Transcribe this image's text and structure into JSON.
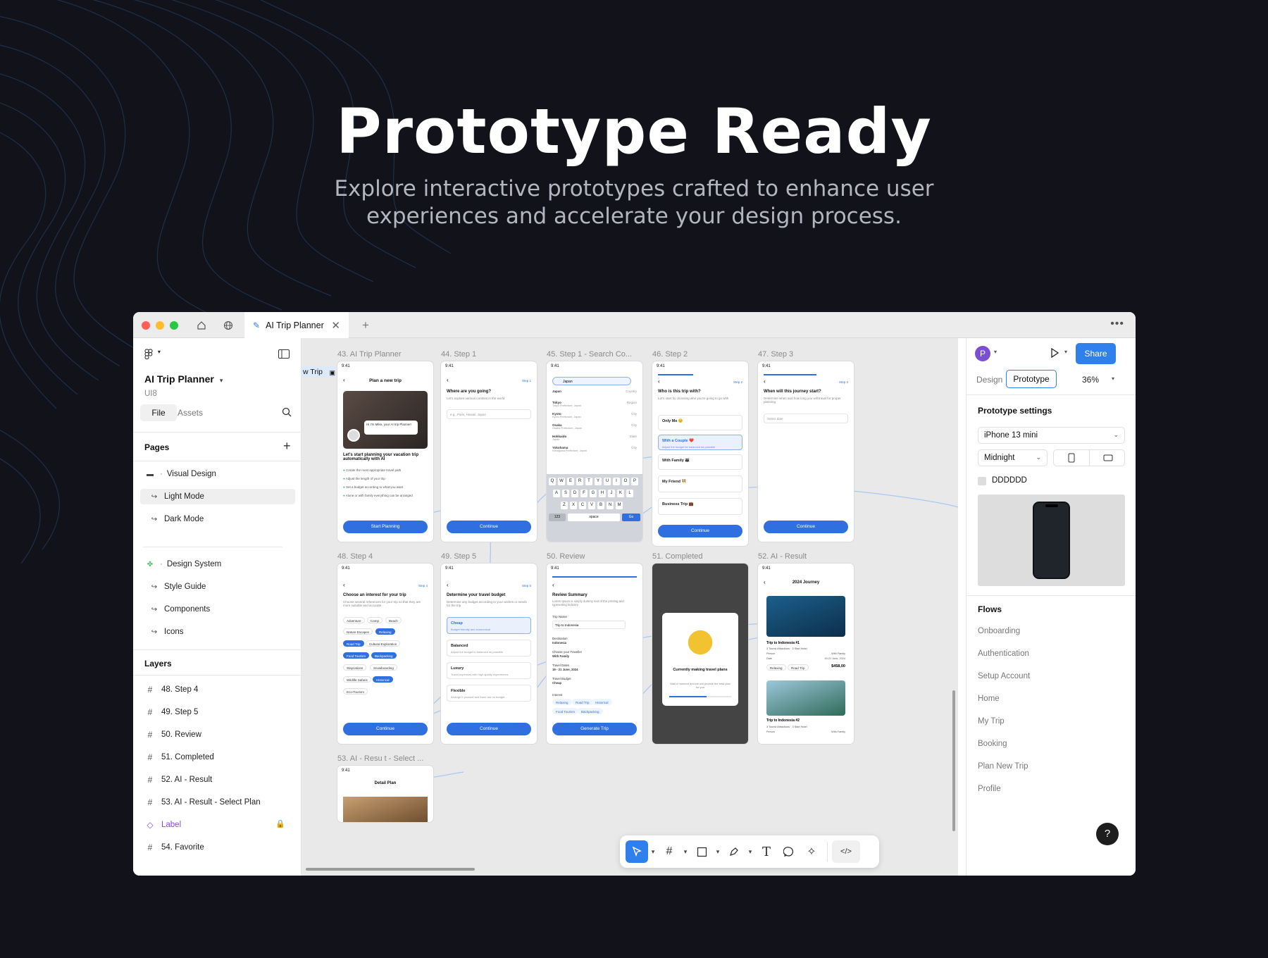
{
  "hero": {
    "title": "Prototype Ready",
    "subtitle_line1": "Explore interactive prototypes crafted to enhance user",
    "subtitle_line2": "experiences and accelerate your design process."
  },
  "tabbar": {
    "tab_label": "AI Trip Planner",
    "new_tab": "+",
    "more": "•••"
  },
  "left_panel": {
    "file_name": "AI Trip Planner",
    "team": "UI8",
    "tabs": [
      "File",
      "Assets"
    ],
    "pages_header": "Pages",
    "pages": [
      {
        "label": "Visual Design",
        "icon": "visual-design-icon"
      },
      {
        "label": "Light Mode",
        "icon": "return-arrow-icon",
        "selected": true
      },
      {
        "label": "Dark Mode",
        "icon": "return-arrow-icon"
      },
      {
        "label": "Design System",
        "icon": "design-system-icon"
      },
      {
        "label": "Style Guide",
        "icon": "return-arrow-icon"
      },
      {
        "label": "Components",
        "icon": "return-arrow-icon"
      },
      {
        "label": "Icons",
        "icon": "return-arrow-icon"
      }
    ],
    "layers_header": "Layers",
    "layers": [
      {
        "label": "48. Step 4",
        "icon": "frame-icon"
      },
      {
        "label": "49. Step 5",
        "icon": "frame-icon"
      },
      {
        "label": "50. Review",
        "icon": "frame-icon"
      },
      {
        "label": "51. Completed",
        "icon": "frame-icon"
      },
      {
        "label": "52. AI - Result",
        "icon": "frame-icon"
      },
      {
        "label": "53. AI - Result - Select Plan",
        "icon": "frame-icon"
      },
      {
        "label": "Label",
        "icon": "component-icon",
        "locked": true
      },
      {
        "label": "54. Favorite",
        "icon": "frame-icon"
      }
    ]
  },
  "canvas": {
    "edge_label": "w Trip",
    "frames": [
      "43. AI Trip Planner",
      "44. Step 1",
      "45. Step 1 - Search Co...",
      "46. Step 2",
      "47. Step 3",
      "48. Step 4",
      "49. Step 5",
      "50. Review",
      "51. Completed",
      "52. AI - Result",
      "53. AI - Resu t - Select ..."
    ],
    "screens": {
      "status_time": "9:41",
      "plan_title": "Plan a new trip",
      "plan_bubble": "Hi I'm Mike, your AI trip Planner!",
      "plan_heading": "Let's start planning your vacation trip automatically with AI",
      "plan_bullets": [
        "Create the most appropriate travel path",
        "Adjust the length of your trip",
        "Set a budget according to what you want",
        "Alone or with family everything can be arranged"
      ],
      "start_planning": "Start Planning",
      "continue": "Continue",
      "step1_q": "Where are you going?",
      "step1_hint": "Let's explore various contries in the world",
      "step1_placeholder": "e.g., Paris, Hawaii, Japan",
      "step_label": "Step 1",
      "search_value": "Japan",
      "search_results": [
        {
          "name": "Japan",
          "type": "Country",
          "sub": ""
        },
        {
          "name": "Tokyo",
          "type": "Region",
          "sub": "Tokyo Prefecture, Japan"
        },
        {
          "name": "Kyoto",
          "type": "City",
          "sub": "Kyoto Prefecture, Japan"
        },
        {
          "name": "Osaka",
          "type": "City",
          "sub": "Osaka Prefecture, Japan"
        },
        {
          "name": "Hokkaido",
          "type": "State",
          "sub": "Japan"
        },
        {
          "name": "Yokohama",
          "type": "City",
          "sub": "Kanagawa Prefecture, Japan"
        }
      ],
      "keyboard_rows": [
        [
          "Q",
          "W",
          "E",
          "R",
          "T",
          "Y",
          "U",
          "I",
          "O",
          "P"
        ],
        [
          "A",
          "S",
          "D",
          "F",
          "G",
          "H",
          "J",
          "K",
          "L"
        ],
        [
          "Z",
          "X",
          "C",
          "V",
          "B",
          "N",
          "M"
        ]
      ],
      "key_123": "123",
      "key_space": "space",
      "key_go": "Go",
      "step2_label": "Step 2",
      "step2_q": "Who is this trip with?",
      "step2_hint": "Let's start by choosing who you're going to go with",
      "step2_options": [
        "Only Me 😊",
        "With a Couple ❤️",
        "With Family 👨‍👩‍👧",
        "My Friend 👯",
        "Business Trip 💼"
      ],
      "step2_selected_hint": "Adjust the budget be balanced as possible",
      "step3_label": "Step 3",
      "step3_q": "When will this journey start?",
      "step3_hint": "Determine when and how long you will travel for proper planning",
      "step3_placeholder": "Select date",
      "step4_label": "Step 4",
      "step4_q": "Choose an interest for your trip",
      "step4_hint": "Choose several references for your trip so that they are more suitable and accurate",
      "interests": [
        {
          "label": "Adventure",
          "on": false
        },
        {
          "label": "Camp",
          "on": false
        },
        {
          "label": "Beach",
          "on": false
        },
        {
          "label": "Nature Escapes",
          "on": false
        },
        {
          "label": "Relaxing",
          "on": true
        },
        {
          "label": "Road Trip",
          "on": true
        },
        {
          "label": "Cultural Exploration",
          "on": false
        },
        {
          "label": "Food Tourism",
          "on": true
        },
        {
          "label": "Backpacking",
          "on": true
        },
        {
          "label": "Staycations",
          "on": false
        },
        {
          "label": "Snowboarding",
          "on": false
        },
        {
          "label": "Wildlife Safaris",
          "on": false
        },
        {
          "label": "Historical",
          "on": true
        },
        {
          "label": "Eco-Tourism",
          "on": false
        }
      ],
      "step5_label": "Step 5",
      "step5_q": "Determine your travel budget",
      "step5_hint": "Determine any budget according to your wishes or needs for the trip",
      "budgets": [
        {
          "t": "Cheap",
          "d": "Budget friendly and economical"
        },
        {
          "t": "Balanced",
          "d": "Adjust the budget to balanced as possible"
        },
        {
          "t": "Luxury",
          "d": "Travel expenses with high quality experiences"
        },
        {
          "t": "Flexible",
          "d": "Arrange it yourself and there are no budget..."
        }
      ],
      "review_title": "Review Summary",
      "review_hint": "Lorem Ipsum is simply dummy text of the printing and typesetting industry",
      "trip_name_label": "Trip Name",
      "trip_name": "Trip to Indonesia",
      "review_rows": [
        {
          "l": "Destination",
          "v": "Indonesia"
        },
        {
          "l": "Choose your Traveller",
          "v": "With Family"
        },
        {
          "l": "Travel Dates",
          "v": "19 - 21 June, 2024"
        },
        {
          "l": "Travel Budget",
          "v": "Cheap"
        }
      ],
      "interest_label": "Interest",
      "review_chips": [
        "Relaxing",
        "Road Trip",
        "Historical",
        "Food Tourism",
        "Backpacking"
      ],
      "generate_trip": "Generate Trip",
      "completed_title": "Currently making travel plans",
      "completed_hint": "Wait a moment and we will provide the best plan for you",
      "result_title": "2024 Journey",
      "result_trip1": "Trip to Indonesia #1",
      "result_trip2": "Trip to Indonesia #2",
      "result_meta1": "3 Tourist Attractions",
      "result_meta2": "3 Start Hotel",
      "result_person_l": "Person",
      "result_person_v": "With Family",
      "result_date_l": "Date",
      "result_date_v": "19-21 June, 2024",
      "result_price": "$458,00",
      "result_tags": [
        "Relaxing",
        "Road Trip"
      ],
      "detail_title": "Detail Plan"
    }
  },
  "right_panel": {
    "avatar_initial": "P",
    "share": "Share",
    "tabs": [
      "Design",
      "Prototype"
    ],
    "active_tab": "Prototype",
    "zoom": "36%",
    "settings_header": "Prototype settings",
    "device": "iPhone 13 mini",
    "color": "Midnight",
    "bg_hex": "DDDDDD",
    "flows_header": "Flows",
    "flows": [
      "Onboarding",
      "Authentication",
      "Setup Account",
      "Home",
      "My Trip",
      "Booking",
      "Plan New Trip",
      "Profile"
    ],
    "help": "?"
  },
  "colors": {
    "page_bg": "#11121a",
    "accent": "#2f80ed",
    "phone_button": "#2f6fdf",
    "purple": "#8a4ad9"
  }
}
